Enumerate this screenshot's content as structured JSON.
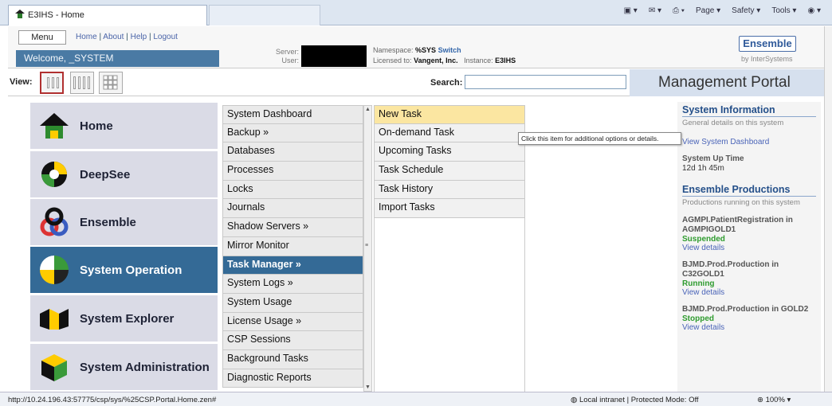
{
  "browser": {
    "tab_title": "E3IHS - Home",
    "commands": [
      "Page ▾",
      "Safety ▾",
      "Tools ▾"
    ],
    "status_url": "http://10.24.196.43:57775/csp/sys/%25CSP.Portal.Home.zen#",
    "status_zone": "Local intranet | Protected Mode: Off",
    "status_zoom": "100%"
  },
  "header": {
    "menu_label": "Menu",
    "links": [
      "Home",
      "About",
      "Help",
      "Logout"
    ],
    "welcome": "Welcome, _SYSTEM",
    "server_label": "Server:",
    "user_label": "User:",
    "namespace_label": "Namespace:",
    "namespace_value": "%SYS",
    "switch_label": "Switch",
    "licensed_label": "Licensed to:",
    "licensed_value": "Vangent, Inc.",
    "instance_label": "Instance:",
    "instance_value": "E3IHS",
    "logo_text": "Ensemble",
    "logo_sub": "by InterSystems"
  },
  "viewbar": {
    "view_label": "View:",
    "search_label": "Search:",
    "search_value": "",
    "portal_title": "Management Portal"
  },
  "nav": [
    {
      "label": "Home",
      "icon": "home-icon"
    },
    {
      "label": "DeepSee",
      "icon": "deepsee-icon"
    },
    {
      "label": "Ensemble",
      "icon": "ensemble-icon"
    },
    {
      "label": "System Operation",
      "icon": "system-operation-icon"
    },
    {
      "label": "System Explorer",
      "icon": "system-explorer-icon"
    },
    {
      "label": "System Administration",
      "icon": "system-administration-icon"
    }
  ],
  "menu1": [
    "System Dashboard",
    "Backup »",
    "Databases",
    "Processes",
    "Locks",
    "Journals",
    "Shadow Servers »",
    "Mirror Monitor",
    "Task Manager »",
    "System Logs »",
    "System Usage",
    "License Usage »",
    "CSP Sessions",
    "Background Tasks",
    "Diagnostic Reports"
  ],
  "menu2": [
    "New Task",
    "On-demand Task",
    "Upcoming Tasks",
    "Task Schedule",
    "Task History",
    "Import Tasks"
  ],
  "tooltip": "Click this item for additional options or details.",
  "info": {
    "sysinfo_title": "System Information",
    "sysinfo_sub": "General details on this system",
    "dashboard_link": "View System Dashboard",
    "uptime_label": "System Up Time",
    "uptime_value": "12d 1h 45m",
    "prod_title": "Ensemble Productions",
    "prod_sub": "Productions running on this system",
    "productions": [
      {
        "name": "AGMPI.PatientRegistration in AGMPIGOLD1",
        "status": "Suspended",
        "link": "View details"
      },
      {
        "name": "BJMD.Prod.Production in C32GOLD1",
        "status": "Running",
        "link": "View details"
      },
      {
        "name": "BJMD.Prod.Production in GOLD2",
        "status": "Stopped",
        "link": "View details"
      }
    ]
  }
}
